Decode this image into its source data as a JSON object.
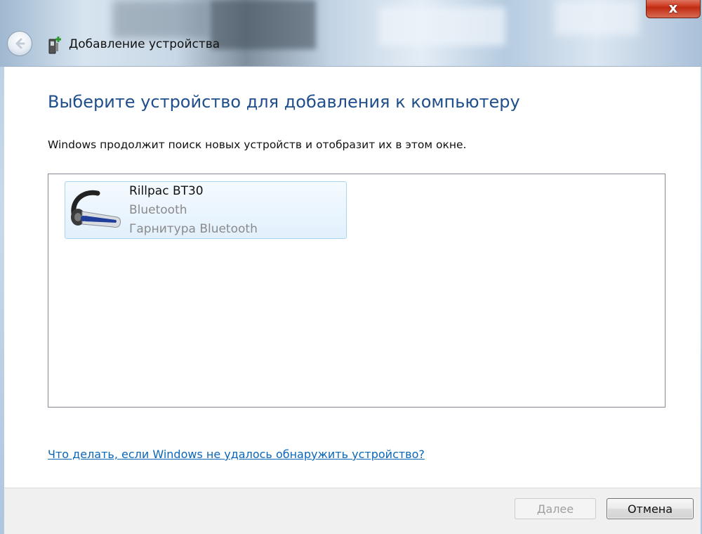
{
  "window": {
    "title": "Добавление устройства",
    "close_label": "x"
  },
  "main": {
    "heading": "Выберите устройство для добавления к компьютеру",
    "subtext": "Windows продолжит поиск новых устройств и отобразит их в этом окне.",
    "devices": [
      {
        "name": "Rillpac BT30",
        "type": "Bluetooth",
        "category": "Гарнитура Bluetooth",
        "icon": "bluetooth-headset-icon"
      }
    ],
    "help_link": "Что делать, если Windows не удалось обнаружить устройство?"
  },
  "footer": {
    "next_label": "Далее",
    "cancel_label": "Отмена"
  },
  "colors": {
    "heading": "#1e4e8c",
    "link": "#0a66b8",
    "selection_border": "#a9d6f3",
    "close_red": "#c02b12"
  }
}
